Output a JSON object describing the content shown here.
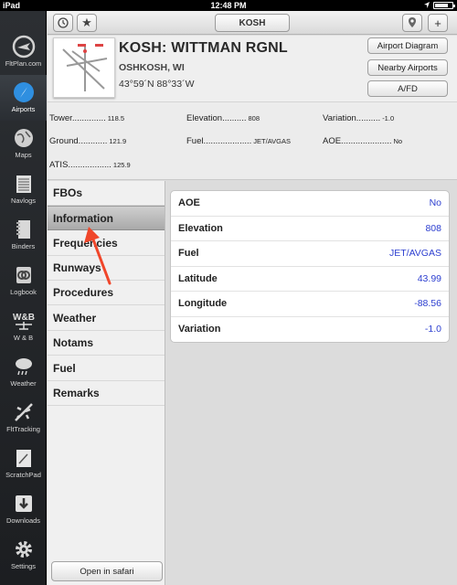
{
  "status": {
    "device": "iPad",
    "time": "12:48 PM"
  },
  "sidebar": {
    "items": [
      {
        "label": "FltPlan.com",
        "icon": "fltplan-logo-icon"
      },
      {
        "label": "Airports",
        "icon": "compass-icon",
        "active": true
      },
      {
        "label": "Maps",
        "icon": "globe-icon"
      },
      {
        "label": "Navlogs",
        "icon": "navlog-icon"
      },
      {
        "label": "Binders",
        "icon": "binder-icon"
      },
      {
        "label": "Logbook",
        "icon": "logbook-icon"
      },
      {
        "label": "W & B",
        "icon": "weight-balance-icon"
      },
      {
        "label": "Weather",
        "icon": "cloud-rain-icon"
      },
      {
        "label": "FltTracking",
        "icon": "plane-icon"
      },
      {
        "label": "ScratchPad",
        "icon": "scratchpad-icon"
      },
      {
        "label": "Downloads",
        "icon": "download-icon"
      },
      {
        "label": "Settings",
        "icon": "gear-icon"
      }
    ]
  },
  "toolbar": {
    "airport_code": "KOSH"
  },
  "airport": {
    "title": "KOSH: WITTMAN RGNL",
    "city": "OSHKOSH, WI",
    "coords": "43°59´N  88°33´W",
    "buttons": {
      "diagram": "Airport Diagram",
      "nearby": "Nearby Airports",
      "afd": "A/FD"
    }
  },
  "info": {
    "tower_label": "Tower..............",
    "tower_value": "118.5",
    "ground_label": "Ground............",
    "ground_value": "121.9",
    "atis_label": "ATIS..................",
    "atis_value": "125.9",
    "elevation_label": "Elevation..........",
    "elevation_value": "808",
    "fuel_label": "Fuel....................",
    "fuel_value": "JET/AVGAS",
    "variation_label": "Variation..........",
    "variation_value": "-1.0",
    "aoe_label": "AOE.....................",
    "aoe_value": "No"
  },
  "categories": [
    "FBOs",
    "Information",
    "Frequencies",
    "Runways",
    "Procedures",
    "Weather",
    "Notams",
    "Fuel",
    "Remarks"
  ],
  "selected_category": "Information",
  "open_safari_label": "Open in safari",
  "details": [
    {
      "key": "AOE",
      "value": "No"
    },
    {
      "key": "Elevation",
      "value": "808"
    },
    {
      "key": "Fuel",
      "value": "JET/AVGAS"
    },
    {
      "key": "Latitude",
      "value": "43.99"
    },
    {
      "key": "Longitude",
      "value": "-88.56"
    },
    {
      "key": "Variation",
      "value": "-1.0"
    }
  ],
  "colors": {
    "sidebar_bg": "#24272b",
    "value_blue": "#2d3fd0",
    "arrow_red": "#f0462a"
  }
}
